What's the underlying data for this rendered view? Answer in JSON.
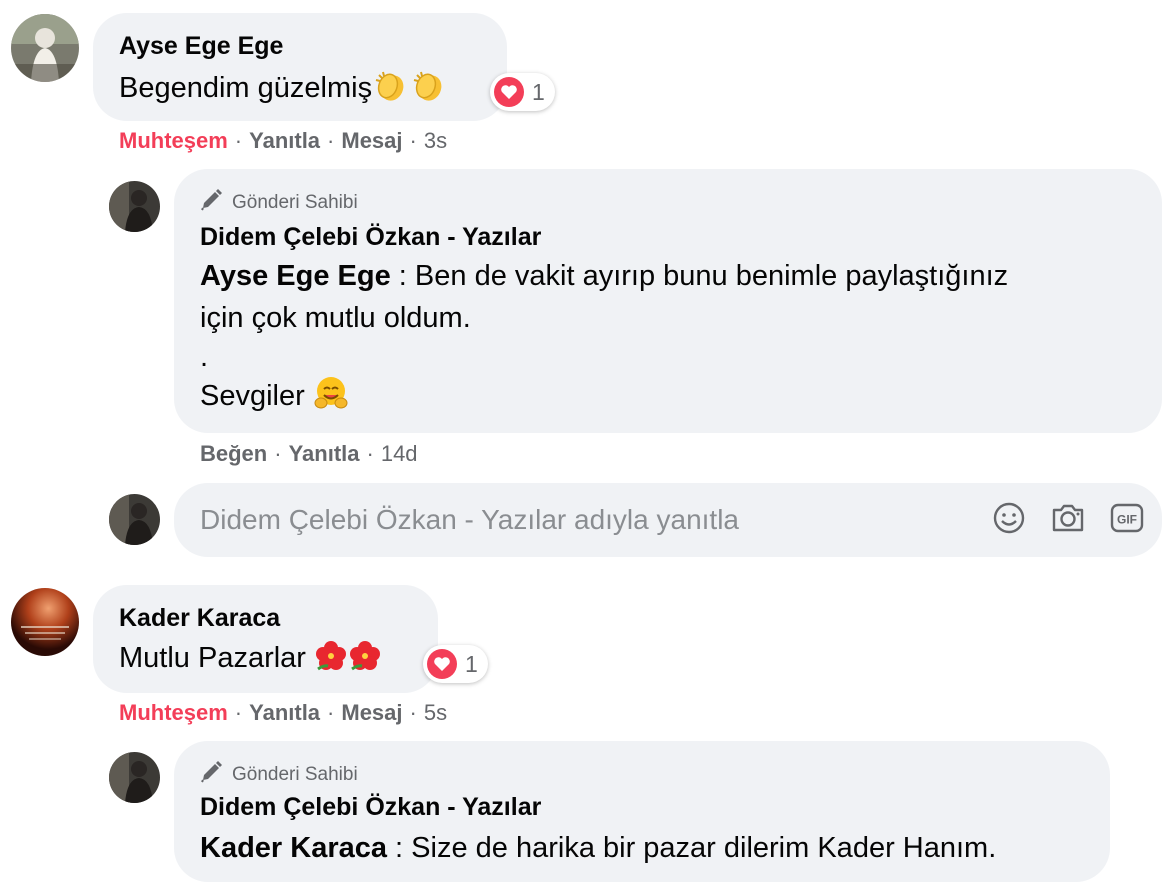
{
  "comments": [
    {
      "author": "Ayse Ege Ege",
      "text": "Begendim güzelmiş",
      "reaction_count": "1",
      "actions": {
        "reacted": "Muhteşem",
        "reply": "Yanıtla",
        "message": "Mesaj",
        "time": "3s"
      },
      "reply": {
        "badge": "Gönderi Sahibi",
        "author": "Didem Çelebi Özkan - Yazılar",
        "mention": "Ayse Ege Ege",
        "text_line1": " : Ben de vakit ayırıp bunu benimle paylaştığınız",
        "text_line2": "için çok mutlu oldum.",
        "text_line3": ".",
        "text_line4": "Sevgiler",
        "actions": {
          "like": "Beğen",
          "reply": "Yanıtla",
          "time": "14d"
        }
      }
    },
    {
      "author": "Kader Karaca",
      "text": "Mutlu Pazarlar",
      "reaction_count": "1",
      "actions": {
        "reacted": "Muhteşem",
        "reply": "Yanıtla",
        "message": "Mesaj",
        "time": "5s"
      },
      "reply": {
        "badge": "Gönderi Sahibi",
        "author": "Didem Çelebi Özkan - Yazılar",
        "mention": "Kader Karaca",
        "text_line1": " : Size de harika bir pazar dilerim Kader Hanım."
      }
    }
  ],
  "reply_box": {
    "placeholder": "Didem Çelebi Özkan - Yazılar adıyla yanıtla"
  },
  "icons": {
    "emoji": "smiley-icon",
    "camera": "camera-icon",
    "gif": "gif-icon",
    "gif_label": "GIF",
    "badge": "pencil-icon",
    "reaction": "heart-icon",
    "emoji_clap": "clapping-hands-icon",
    "emoji_hug": "hugging-face-icon",
    "emoji_flower": "hibiscus-icon"
  },
  "colors": {
    "accent_reaction": "#f33e58",
    "bubble": "#f0f2f5",
    "meta": "#65676b"
  }
}
